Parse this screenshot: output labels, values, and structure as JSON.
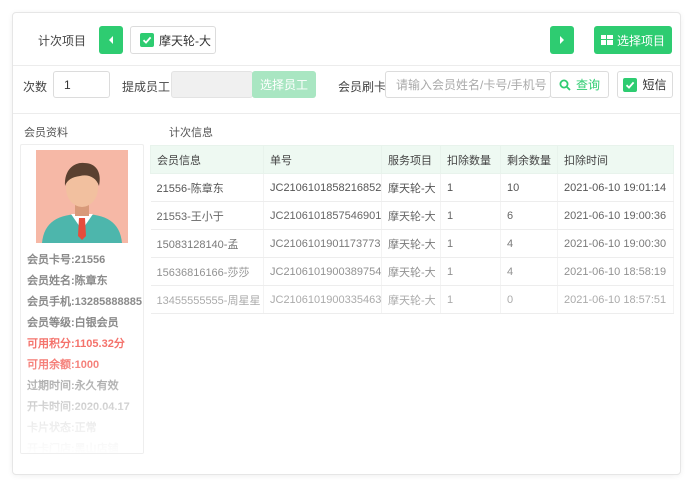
{
  "toolbar": {
    "count_item_label": "计次项目",
    "selected_item": "摩天轮-大",
    "select_item_button": "选择项目"
  },
  "form": {
    "times_label": "次数",
    "times_value": "1",
    "commission_label": "提成员工",
    "select_staff_button": "选择员工",
    "card_swipe_label": "会员刷卡",
    "search_placeholder": "请输入会员姓名/卡号/手机号",
    "query_button": "查询",
    "sms_label": "短信",
    "sms_checked": true
  },
  "member": {
    "section_title": "会员资料",
    "lines": [
      {
        "text": "会员卡号:21556",
        "tone": "normal"
      },
      {
        "text": "会员姓名:陈章东",
        "tone": "normal"
      },
      {
        "text": "会员手机:13285888885",
        "tone": "normal"
      },
      {
        "text": "会员等级:白银会员",
        "tone": "normal"
      },
      {
        "text": "可用积分:1105.32分",
        "tone": "red"
      },
      {
        "text": "可用余额:1000",
        "tone": "red"
      },
      {
        "text": "过期时间:永久有效",
        "tone": "normal"
      },
      {
        "text": "开卡时间:2020.04.17",
        "tone": "normal"
      },
      {
        "text": "卡片状态:正常",
        "tone": "normal"
      },
      {
        "text": "开卡门店:黑山店铺",
        "tone": "normal"
      }
    ]
  },
  "records": {
    "section_title": "计次信息",
    "columns": [
      "会员信息",
      "单号",
      "服务项目",
      "扣除数量",
      "剩余数量",
      "扣除时间"
    ],
    "rows": [
      [
        "21556-陈章东",
        "JC2106101858216852",
        "摩天轮-大",
        "1",
        "10",
        "2021-06-10  19:01:14"
      ],
      [
        "21553-王小于",
        "JC2106101857546901",
        "摩天轮-大",
        "1",
        "6",
        "2021-06-10  19:00:36"
      ],
      [
        "15083128140-孟",
        "JC2106101901173773",
        "摩天轮-大",
        "1",
        "4",
        "2021-06-10  19:00:30"
      ],
      [
        "15636816166-莎莎",
        "JC2106101900389754",
        "摩天轮-大",
        "1",
        "4",
        "2021-06-10  18:58:19"
      ],
      [
        "13455555555-周星星",
        "JC2106101900335463",
        "摩天轮-大",
        "1",
        "0",
        "2021-06-10  18:57:51"
      ]
    ],
    "row_text_colors": [
      "#555555",
      "#666666",
      "#7a7a7a",
      "#929292",
      "#ababab"
    ]
  },
  "colors": {
    "accent": "#2ecc71",
    "accent_light": "#a9e6c2",
    "table_header_bg": "#eef9f2",
    "red": "#f4726b",
    "member_text": "#8a8a8a"
  },
  "icons": {
    "prev": "chevron-left-icon",
    "next": "chevron-right-icon",
    "check": "check-icon",
    "grid": "grid-icon",
    "search": "search-icon",
    "avatar": "person-avatar"
  }
}
